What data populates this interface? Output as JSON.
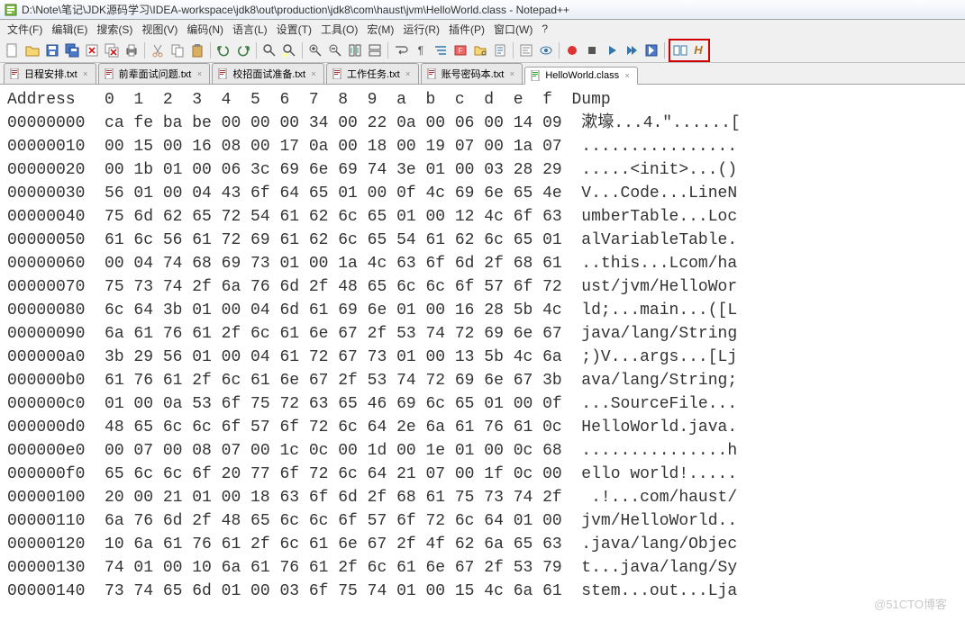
{
  "title": "D:\\Note\\笔记\\JDK源码学习\\IDEA-workspace\\jdk8\\out\\production\\jdk8\\com\\haust\\jvm\\HelloWorld.class - Notepad++",
  "menus": {
    "file": "文件(F)",
    "edit": "编辑(E)",
    "search": "搜索(S)",
    "view": "视图(V)",
    "encoding": "编码(N)",
    "language": "语言(L)",
    "settings": "设置(T)",
    "tools": "工具(O)",
    "macro": "宏(M)",
    "run": "运行(R)",
    "plugins": "插件(P)",
    "window": "窗口(W)",
    "help": "?"
  },
  "tabs": [
    {
      "label": "日程安排.txt",
      "active": false
    },
    {
      "label": "前辈面试问题.txt",
      "active": false
    },
    {
      "label": "校招面试准备.txt",
      "active": false
    },
    {
      "label": "工作任务.txt",
      "active": false
    },
    {
      "label": "账号密码本.txt",
      "active": false
    },
    {
      "label": "HelloWorld.class",
      "active": true
    }
  ],
  "hex": {
    "header": "Address   0  1  2  3  4  5  6  7  8  9  a  b  c  d  e  f  Dump",
    "rows": [
      "00000000  ca fe ba be 00 00 00 34 00 22 0a 00 06 00 14 09  漱壕...4.\"......[",
      "00000010  00 15 00 16 08 00 17 0a 00 18 00 19 07 00 1a 07  ................",
      "00000020  00 1b 01 00 06 3c 69 6e 69 74 3e 01 00 03 28 29  .....<init>...()",
      "00000030  56 01 00 04 43 6f 64 65 01 00 0f 4c 69 6e 65 4e  V...Code...LineN",
      "00000040  75 6d 62 65 72 54 61 62 6c 65 01 00 12 4c 6f 63  umberTable...Loc",
      "00000050  61 6c 56 61 72 69 61 62 6c 65 54 61 62 6c 65 01  alVariableTable.",
      "00000060  00 04 74 68 69 73 01 00 1a 4c 63 6f 6d 2f 68 61  ..this...Lcom/ha",
      "00000070  75 73 74 2f 6a 76 6d 2f 48 65 6c 6c 6f 57 6f 72  ust/jvm/HelloWor",
      "00000080  6c 64 3b 01 00 04 6d 61 69 6e 01 00 16 28 5b 4c  ld;...main...([L",
      "00000090  6a 61 76 61 2f 6c 61 6e 67 2f 53 74 72 69 6e 67  java/lang/String",
      "000000a0  3b 29 56 01 00 04 61 72 67 73 01 00 13 5b 4c 6a  ;)V...args...[Lj",
      "000000b0  61 76 61 2f 6c 61 6e 67 2f 53 74 72 69 6e 67 3b  ava/lang/String;",
      "000000c0  01 00 0a 53 6f 75 72 63 65 46 69 6c 65 01 00 0f  ...SourceFile...",
      "000000d0  48 65 6c 6c 6f 57 6f 72 6c 64 2e 6a 61 76 61 0c  HelloWorld.java.",
      "000000e0  00 07 00 08 07 00 1c 0c 00 1d 00 1e 01 00 0c 68  ...............h",
      "000000f0  65 6c 6c 6f 20 77 6f 72 6c 64 21 07 00 1f 0c 00  ello world!.....",
      "00000100  20 00 21 01 00 18 63 6f 6d 2f 68 61 75 73 74 2f   .!...com/haust/",
      "00000110  6a 76 6d 2f 48 65 6c 6c 6f 57 6f 72 6c 64 01 00  jvm/HelloWorld..",
      "00000120  10 6a 61 76 61 2f 6c 61 6e 67 2f 4f 62 6a 65 63  .java/lang/Objec",
      "00000130  74 01 00 10 6a 61 76 61 2f 6c 61 6e 67 2f 53 79  t...java/lang/Sy",
      "00000140  73 74 65 6d 01 00 03 6f 75 74 01 00 15 4c 6a 61  stem...out...Lja"
    ]
  },
  "watermark": "@51CTO博客"
}
